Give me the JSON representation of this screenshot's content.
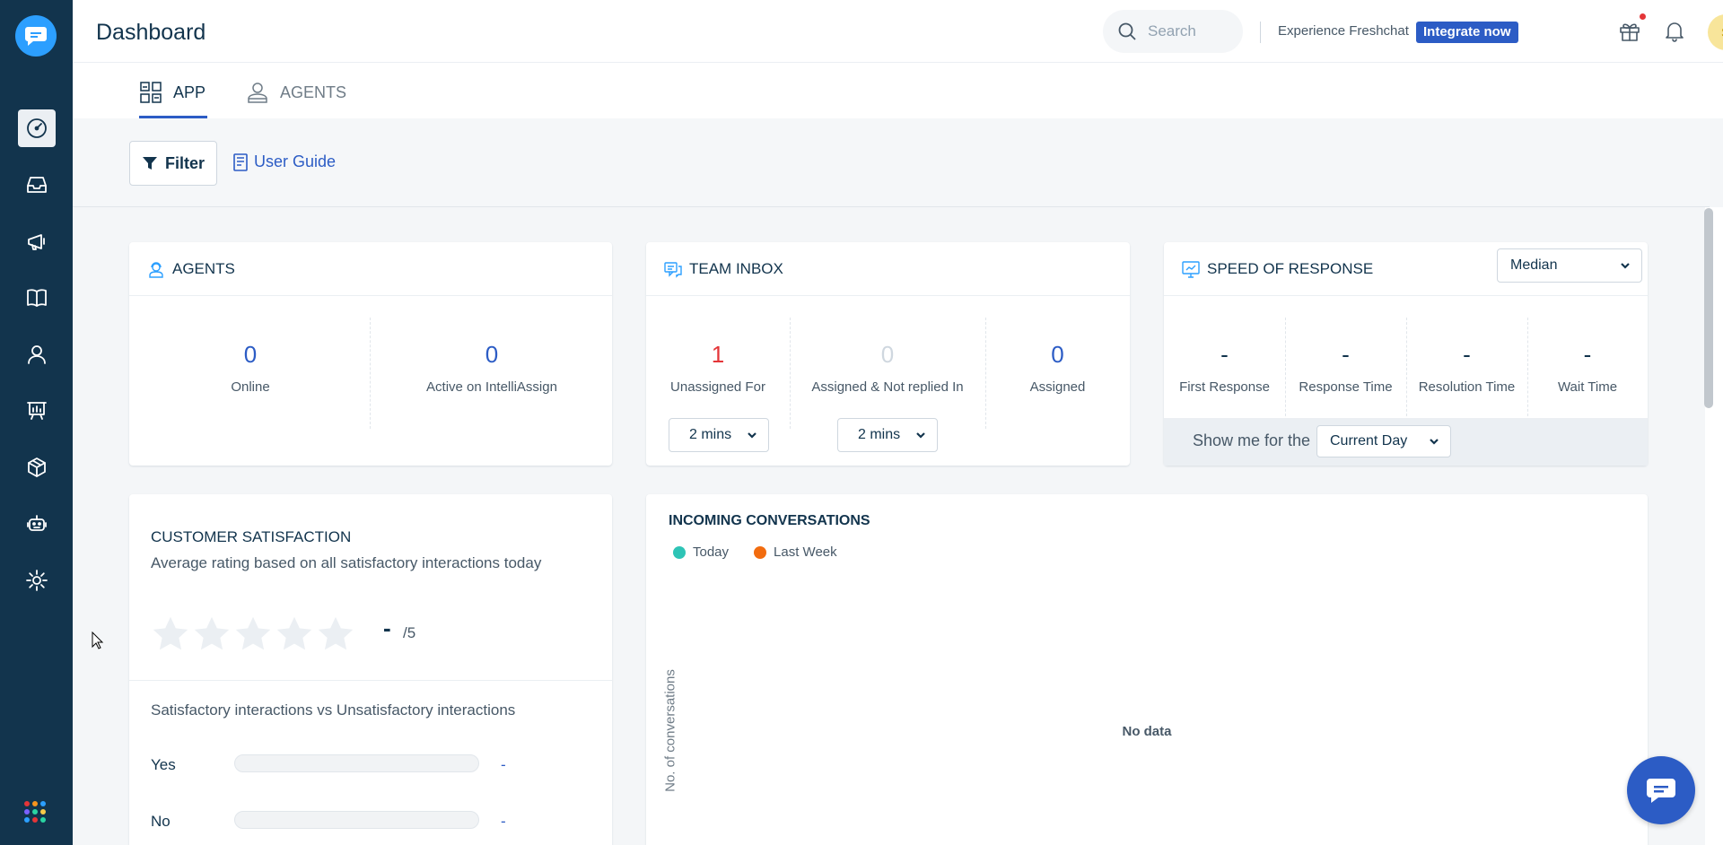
{
  "header": {
    "title": "Dashboard",
    "search_placeholder": "Search",
    "experience_text": "Experience Freshchat",
    "integrate_label": "Integrate now",
    "avatar_initial": "S"
  },
  "sidebar": {
    "items": [
      {
        "name": "dashboard-icon",
        "active": true
      },
      {
        "name": "inbox-icon"
      },
      {
        "name": "campaigns-icon"
      },
      {
        "name": "knowledge-base-icon"
      },
      {
        "name": "contacts-icon"
      },
      {
        "name": "reports-icon"
      },
      {
        "name": "marketplace-icon"
      },
      {
        "name": "bot-icon"
      },
      {
        "name": "settings-icon"
      }
    ],
    "app_dots_colors": [
      "#e43538",
      "#f7941d",
      "#2c9fff",
      "#7b61ff",
      "#2ad4a3",
      "#f7c948",
      "#2c9fff",
      "#e43538",
      "#2ad4a3"
    ]
  },
  "tabs": [
    {
      "label": "APP",
      "icon": "app-grid-icon",
      "active": true
    },
    {
      "label": "AGENTS",
      "icon": "agent-icon",
      "active": false
    }
  ],
  "filter_bar": {
    "filter_label": "Filter",
    "user_guide_label": "User Guide"
  },
  "agents_card": {
    "title": "AGENTS",
    "online_value": "0",
    "online_label": "Online",
    "active_value": "0",
    "active_label": "Active on IntelliAssign"
  },
  "team_inbox_card": {
    "title": "TEAM INBOX",
    "unassigned_value": "1",
    "unassigned_label": "Unassigned For",
    "unassigned_dropdown": "2 mins",
    "not_replied_value": "0",
    "not_replied_label": "Assigned & Not replied In",
    "not_replied_dropdown": "2 mins",
    "assigned_value": "0",
    "assigned_label": "Assigned"
  },
  "speed_card": {
    "title": "SPEED OF RESPONSE",
    "dropdown": "Median",
    "metrics": [
      {
        "value": "-",
        "label": "First Response"
      },
      {
        "value": "-",
        "label": "Response Time"
      },
      {
        "value": "-",
        "label": "Resolution Time"
      },
      {
        "value": "-",
        "label": "Wait Time"
      }
    ],
    "show_me_label": "Show me for the",
    "period_dropdown": "Current Day"
  },
  "csat_card": {
    "title": "CUSTOMER SATISFACTION",
    "subtitle": "Average rating based on all satisfactory interactions today",
    "rating_value": "-",
    "rating_max": "/5",
    "rating_stars_filled": 0,
    "comparison_title": "Satisfactory interactions vs Unsatisfactory interactions",
    "yes_label": "Yes",
    "yes_value": "-",
    "no_label": "No",
    "no_value": "-"
  },
  "incoming_card": {
    "title": "INCOMING CONVERSATIONS",
    "legend_today": "Today",
    "legend_last_week": "Last Week",
    "y_axis_label": "No. of conversations",
    "empty_text": "No data"
  },
  "colors": {
    "sidebar_bg": "#12344d",
    "accent_blue": "#2c5cc5",
    "alert_red": "#e43538",
    "today_teal": "#2ec4b6",
    "last_week_orange": "#f26c0f"
  }
}
